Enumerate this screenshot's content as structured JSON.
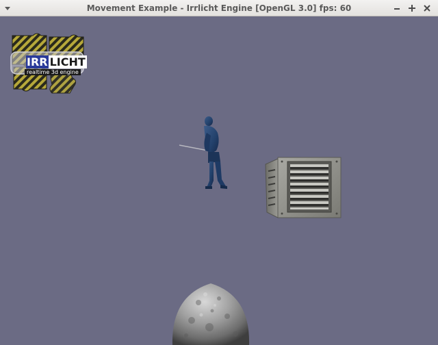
{
  "window": {
    "title": "Movement Example - Irrlicht Engine [OpenGL 3.0] fps: 60",
    "buttons": {
      "minimize": "–",
      "maximize": "+",
      "close": "×"
    }
  },
  "logo": {
    "word_irr": "IRR",
    "word_licht": "LICHT",
    "tagline": "realtime 3d engine"
  },
  "scene": {
    "background_color": "#6b6b84",
    "objects": [
      "ninja-character",
      "metal-crate",
      "stone-sphere"
    ]
  }
}
